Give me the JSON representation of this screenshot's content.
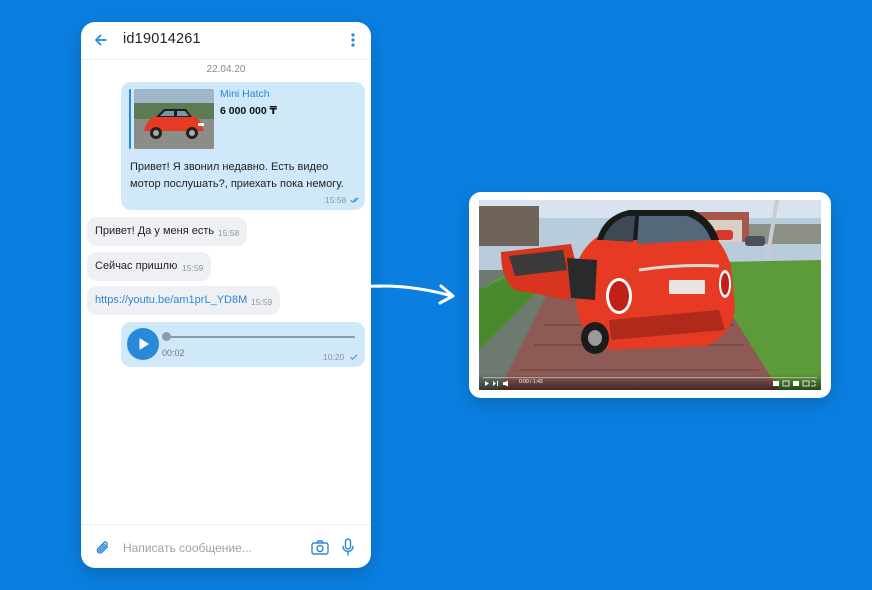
{
  "chat": {
    "title": "id19014261",
    "date_separator": "22.04.20"
  },
  "messages": [
    {
      "direction": "outgoing",
      "ad": {
        "title": "Mini Hatch",
        "price": "6 000 000 ₸"
      },
      "text": "Привет! Я звонил недавно. Есть видео мотор послушать?, приехать пока немогу.",
      "time": "15:58",
      "read": true
    },
    {
      "direction": "incoming",
      "text": "Привет! Да у меня есть",
      "time": "15:58"
    },
    {
      "direction": "incoming",
      "text": "Сейчас пришлю",
      "time": "15:59"
    },
    {
      "direction": "incoming",
      "text": "https://youtu.be/am1prL_YD8M",
      "time": "15:59",
      "is_link": true
    },
    {
      "direction": "outgoing",
      "type": "voice",
      "duration": "00:02",
      "time": "10:20",
      "read": true,
      "progress": 0.0
    }
  ],
  "composer": {
    "placeholder": "Написать сообщение..."
  },
  "video_preview": {
    "time_label": "0:00 / 1:43"
  },
  "icons": {
    "back": "arrow-left-icon",
    "menu": "more-vertical-icon",
    "attach": "paperclip-icon",
    "camera": "camera-icon",
    "mic": "microphone-icon",
    "play": "play-icon",
    "read": "double-check-icon"
  },
  "colors": {
    "background": "#0a7fe0",
    "accent": "#2a88d8",
    "outgoing_bubble": "#cfe8fa",
    "incoming_bubble": "#eef0f3",
    "car": "#e63a25"
  }
}
